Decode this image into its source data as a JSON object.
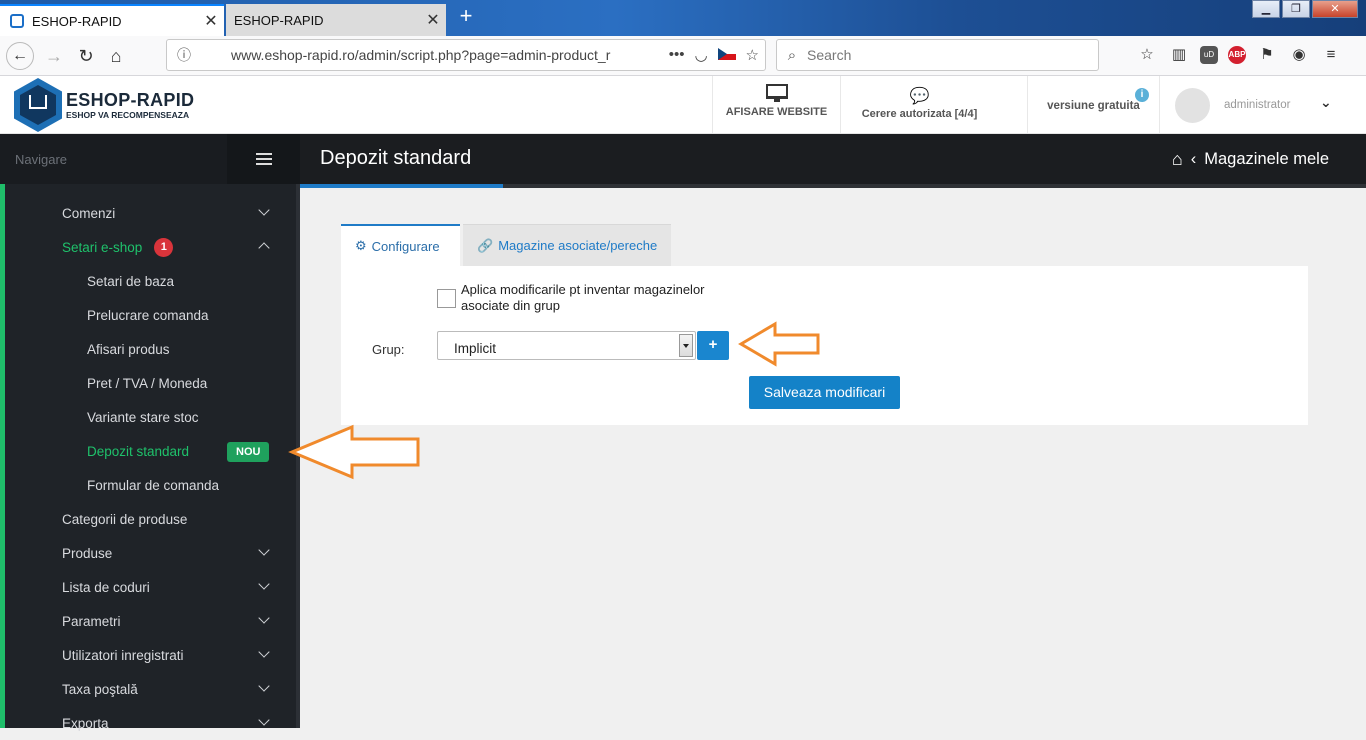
{
  "browser": {
    "tabs": [
      {
        "title": "ESHOP-RAPID",
        "active": true
      },
      {
        "title": "ESHOP-RAPID",
        "active": false
      }
    ],
    "url": "www.eshop-rapid.ro/admin/script.php?page=admin-product_r",
    "search_placeholder": "Search",
    "abp_label": "ABP",
    "ud_label": "uD"
  },
  "header": {
    "brand": "ESHOP-RAPID",
    "slogan": "ESHOP VA RECOMPENSEAZA",
    "website_label": "AFISARE WEBSITE",
    "requests_label": "Cerere autorizata [4/4]",
    "version_label": "versiune gratuita",
    "username": "administrator"
  },
  "sidebar": {
    "nav_label": "Navigare",
    "items": [
      {
        "label": "Comenzi",
        "level": 1,
        "chevron": "down"
      },
      {
        "label": "Setari e-shop",
        "level": 1,
        "chevron": "up",
        "active": true,
        "badge": "1"
      },
      {
        "label": "Setari de baza",
        "level": 2
      },
      {
        "label": "Prelucrare comanda",
        "level": 2
      },
      {
        "label": "Afisari produs",
        "level": 2
      },
      {
        "label": "Pret / TVA / Moneda",
        "level": 2
      },
      {
        "label": "Variante stare stoc",
        "level": 2
      },
      {
        "label": "Depozit standard",
        "level": 2,
        "active": true,
        "tag": "NOU"
      },
      {
        "label": "Formular de comanda",
        "level": 2
      },
      {
        "label": "Categorii de produse",
        "level": 1
      },
      {
        "label": "Produse",
        "level": 1,
        "chevron": "down"
      },
      {
        "label": "Lista de coduri",
        "level": 1,
        "chevron": "down"
      },
      {
        "label": "Parametri",
        "level": 1,
        "chevron": "down"
      },
      {
        "label": "Utilizatori inregistrati",
        "level": 1,
        "chevron": "down"
      },
      {
        "label": "Taxa poştală",
        "level": 1,
        "chevron": "down"
      },
      {
        "label": "Exporta",
        "level": 1,
        "chevron": "down"
      }
    ]
  },
  "main": {
    "title": "Depozit standard",
    "breadcrumb": "Magazinele mele",
    "tabs": [
      {
        "label": "Configurare",
        "active": true
      },
      {
        "label": "Magazine asociate/pereche",
        "active": false
      }
    ],
    "checkbox_label": "Aplica modificarile pt inventar magazinelor asociate din grup",
    "group_label": "Grup:",
    "group_value": "Implicit",
    "add_label": "+",
    "save_label": "Salveaza modificari"
  },
  "colors": {
    "accent_blue": "#1482c8",
    "active_green": "#1fc16b",
    "annotation_orange": "#f08a2c"
  }
}
